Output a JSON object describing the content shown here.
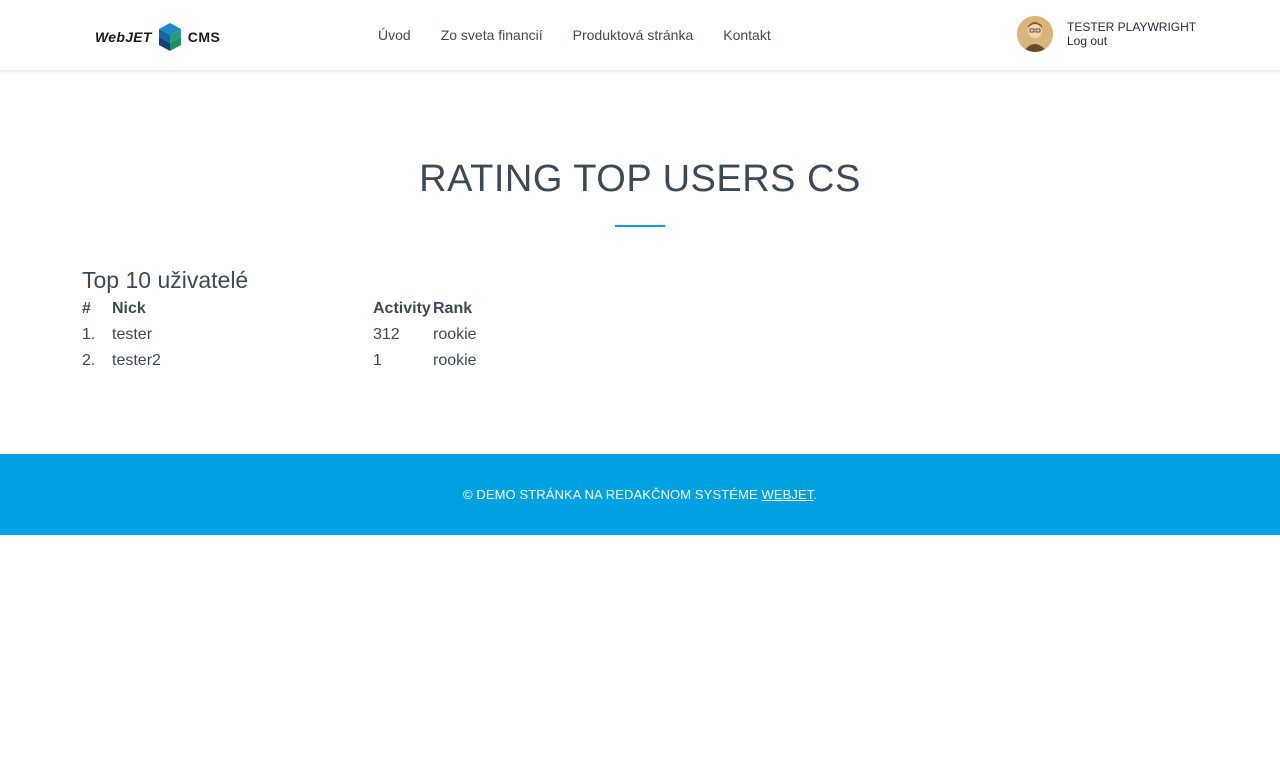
{
  "header": {
    "logo": {
      "word": "WebJET",
      "cms": "CMS",
      "icon": "cube-logo-icon"
    },
    "nav": [
      {
        "label": "Úvod"
      },
      {
        "label": "Zo sveta financií"
      },
      {
        "label": "Produktová stránka"
      },
      {
        "label": "Kontakt"
      }
    ],
    "user": {
      "name": "TESTER PLAYWRIGHT",
      "logout": "Log out",
      "avatar_icon": "user-avatar-icon"
    }
  },
  "main": {
    "title": "RATING TOP USERS CS",
    "section_title": "Top 10 uživatelé",
    "table": {
      "headers": [
        "#",
        "Nick",
        "Activity",
        "Rank"
      ],
      "rows": [
        [
          "1.",
          "tester",
          "312",
          "rookie"
        ],
        [
          "2.",
          "tester2",
          "1",
          "rookie"
        ]
      ]
    }
  },
  "footer": {
    "text": "© DEMO STRÁNKA NA REDAKČNOM SYSTÉME ",
    "link": "WEBJET",
    "suffix": "."
  },
  "colors": {
    "accent": "#00a1e1",
    "text": "#3d4a56"
  }
}
